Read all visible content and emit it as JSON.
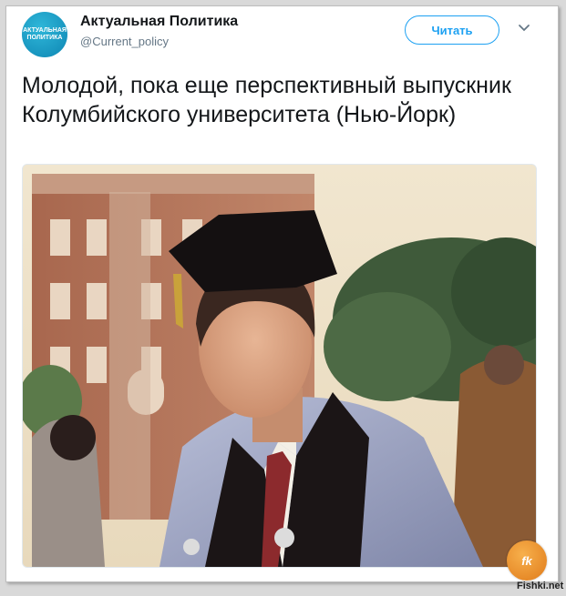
{
  "account": {
    "avatar_line1": "АКТУАЛЬНАЯ",
    "avatar_line2": "ПОЛИТИКА",
    "display_name": "Актуальная Политика",
    "handle": "@Current_policy"
  },
  "actions": {
    "follow_label": "Читать",
    "more_icon": "chevron-down-icon"
  },
  "tweet": {
    "text": "Молодой, пока еще перспективный выпускник Колумбийского университета (Нью-Йорк)"
  },
  "photo": {
    "description_icon": "photo-image"
  },
  "watermark": {
    "badge": "fishka",
    "site": "Fishki.net"
  },
  "colors": {
    "accent": "#1da1f2",
    "text": "#14171a",
    "secondary": "#657786"
  }
}
